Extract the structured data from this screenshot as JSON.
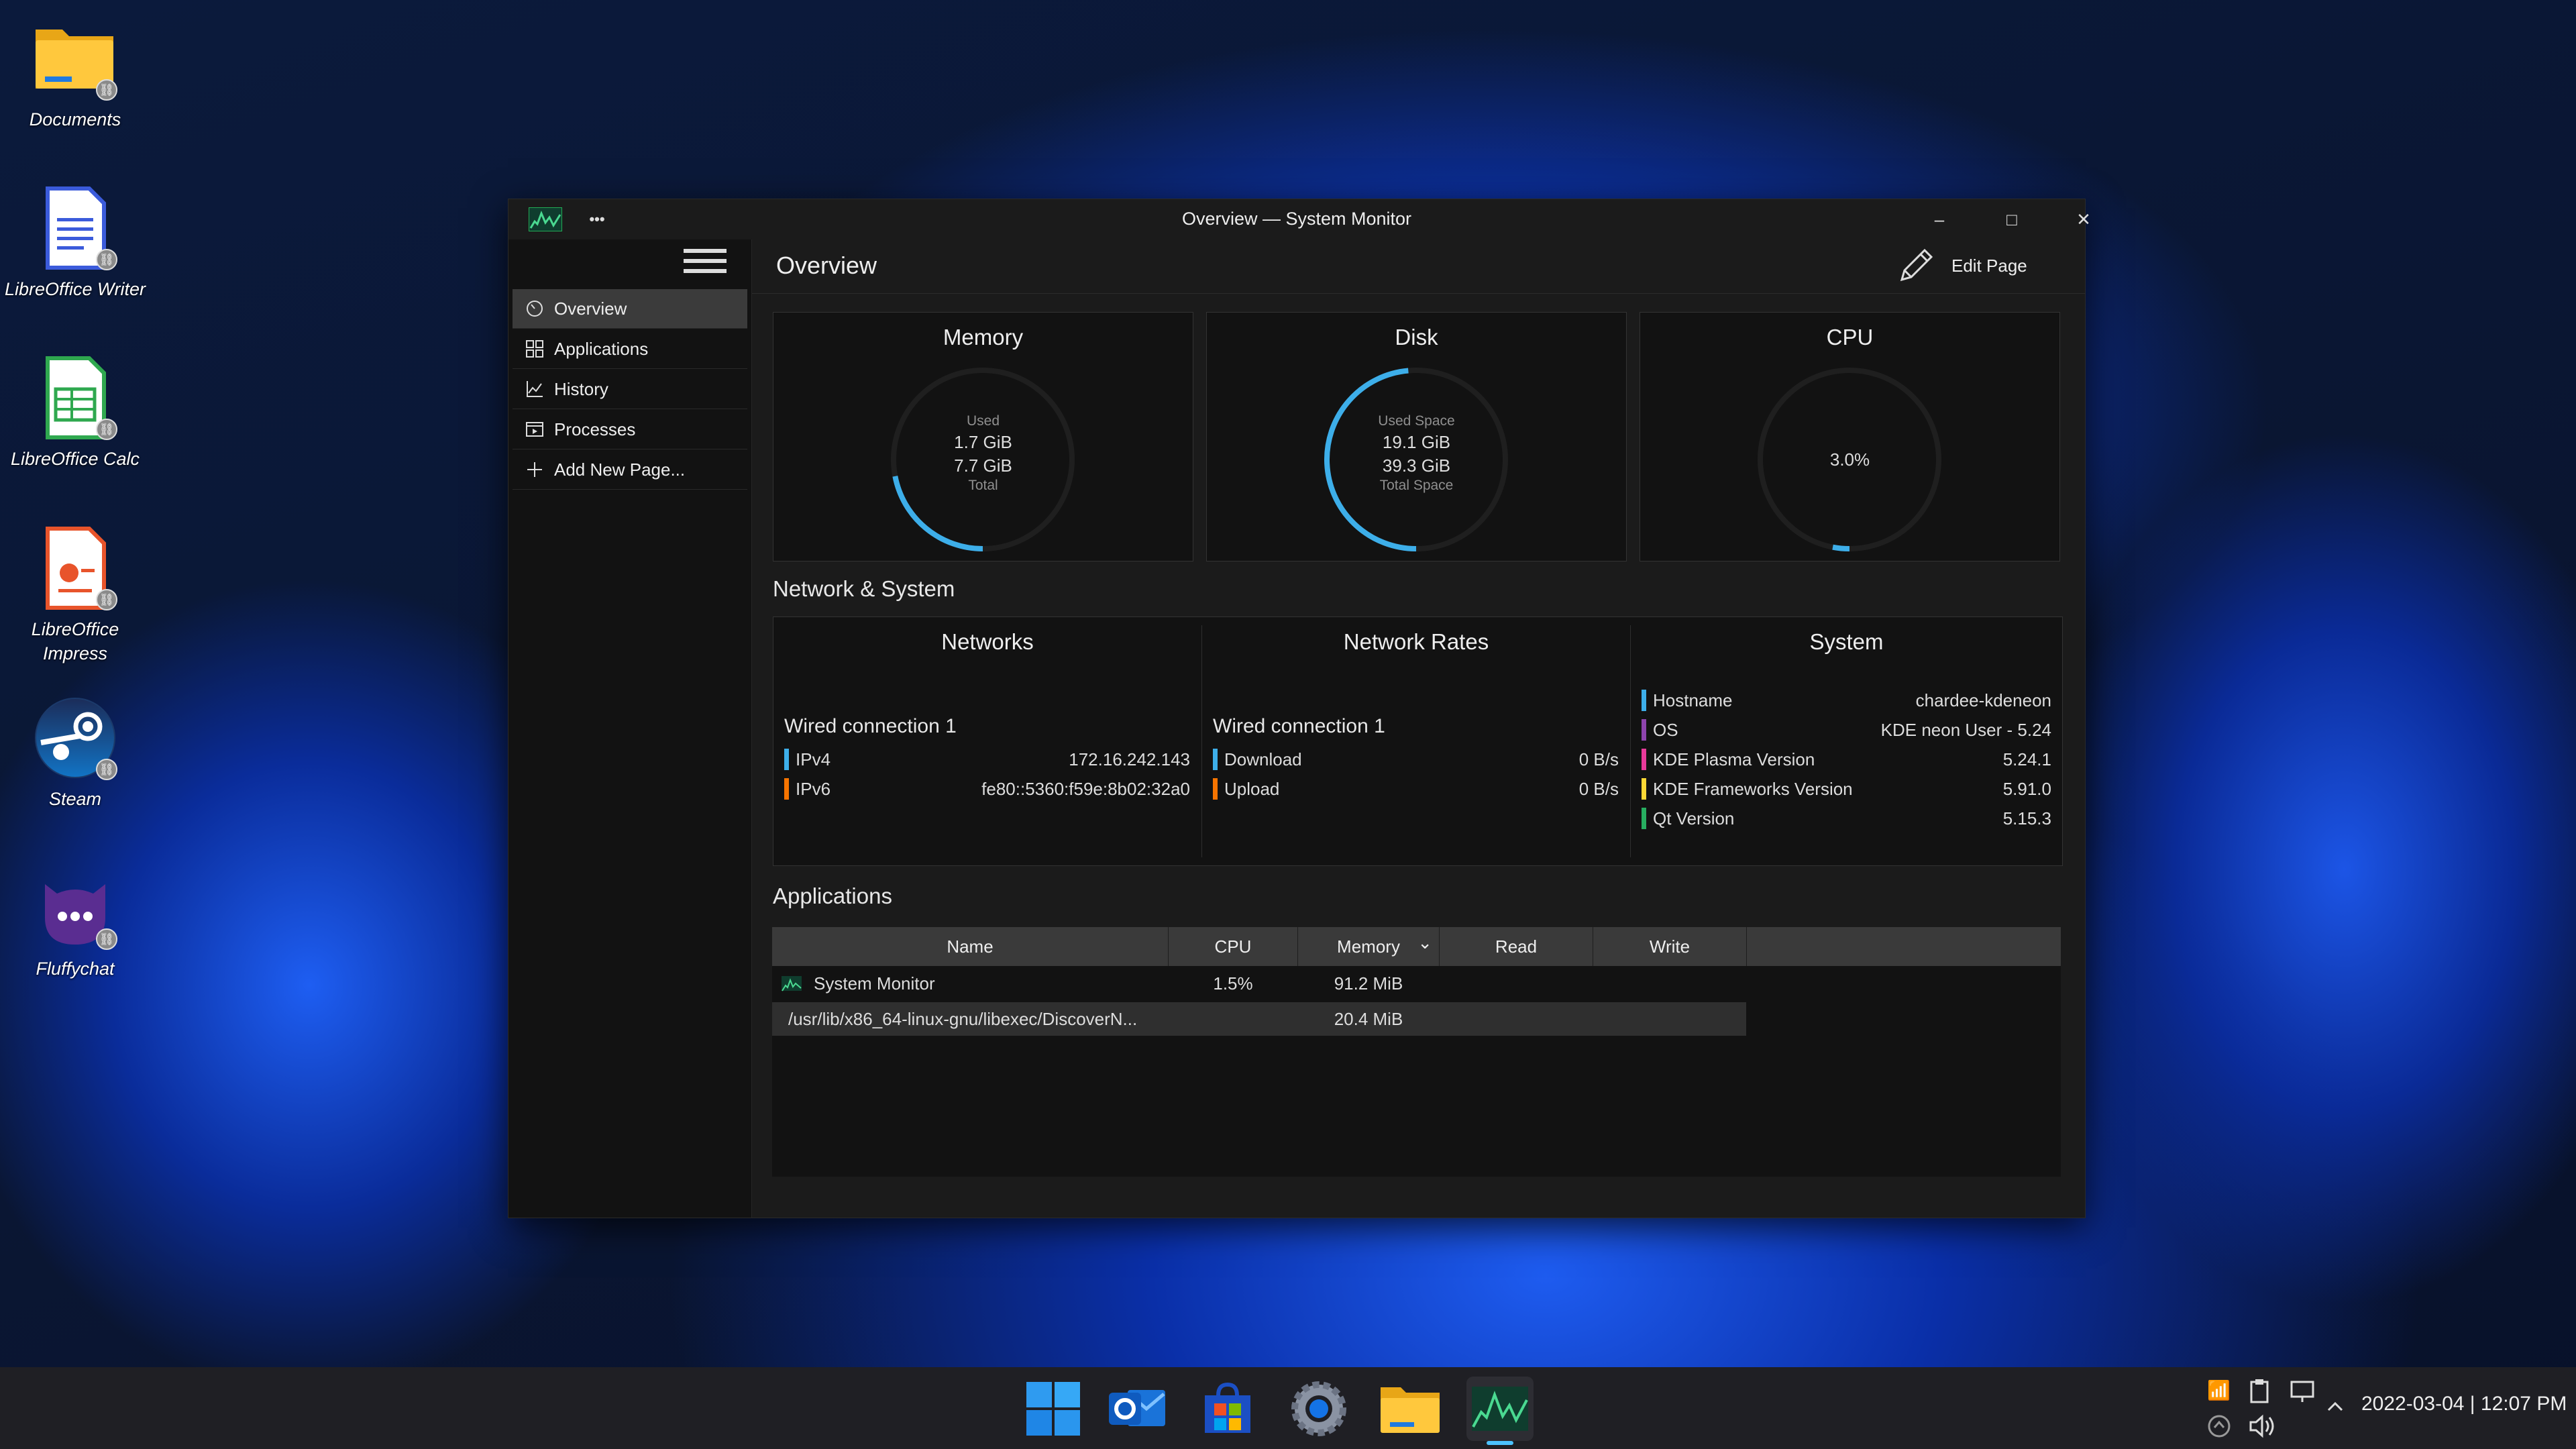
{
  "desktop": {
    "icons": [
      {
        "label": "Documents",
        "icon": "folder-icon"
      },
      {
        "label": "LibreOffice Writer",
        "icon": "libreoffice-writer-icon"
      },
      {
        "label": "LibreOffice Calc",
        "icon": "libreoffice-calc-icon"
      },
      {
        "label": "LibreOffice Impress",
        "icon": "libreoffice-impress-icon"
      },
      {
        "label": "Steam",
        "icon": "steam-icon"
      },
      {
        "label": "Fluffychat",
        "icon": "fluffychat-icon"
      }
    ]
  },
  "window": {
    "title": "Overview — System Monitor",
    "controls": {
      "more": "•••",
      "minimize": "–",
      "maximize": "□",
      "close": "✕"
    }
  },
  "sidebar": {
    "items": [
      {
        "label": "Overview",
        "icon": "overview-icon",
        "active": true
      },
      {
        "label": "Applications",
        "icon": "applications-grid-icon"
      },
      {
        "label": "History",
        "icon": "history-chart-icon"
      },
      {
        "label": "Processes",
        "icon": "processes-icon"
      },
      {
        "label": "Add New Page...",
        "icon": "plus-icon"
      }
    ]
  },
  "header": {
    "title": "Overview",
    "edit_label": "Edit Page"
  },
  "cards": {
    "memory": {
      "title": "Memory",
      "top_label": "Used",
      "used": "1.7 GiB",
      "total": "7.7 GiB",
      "bottom_label": "Total",
      "fraction": 0.22,
      "color": "#3daee9"
    },
    "disk": {
      "title": "Disk",
      "top_label": "Used Space",
      "used": "19.1 GiB",
      "total": "39.3 GiB",
      "bottom_label": "Total Space",
      "fraction": 0.486,
      "color": "#3daee9"
    },
    "cpu": {
      "title": "CPU",
      "value": "3.0%",
      "fraction": 0.03,
      "color": "#3daee9"
    }
  },
  "network_system": {
    "section_title": "Network & System",
    "networks": {
      "title": "Networks",
      "connection": "Wired connection 1",
      "rows": [
        {
          "key": "IPv4",
          "value": "172.16.242.143",
          "color": "#3daee9"
        },
        {
          "key": "IPv6",
          "value": "fe80::5360:f59e:8b02:32a0",
          "color": "#f67400"
        }
      ]
    },
    "rates": {
      "title": "Network Rates",
      "connection": "Wired connection 1",
      "rows": [
        {
          "key": "Download",
          "value": "0 B/s",
          "color": "#3daee9"
        },
        {
          "key": "Upload",
          "value": "0 B/s",
          "color": "#f67400"
        }
      ]
    },
    "system": {
      "title": "System",
      "rows": [
        {
          "key": "Hostname",
          "value": "chardee-kdeneon",
          "color": "#3daee9"
        },
        {
          "key": "OS",
          "value": "KDE neon User - 5.24",
          "color": "#8e44ad"
        },
        {
          "key": "KDE Plasma Version",
          "value": "5.24.1",
          "color": "#e93a9a"
        },
        {
          "key": "KDE Frameworks Version",
          "value": "5.91.0",
          "color": "#fdd835"
        },
        {
          "key": "Qt Version",
          "value": "5.15.3",
          "color": "#27ae60"
        }
      ]
    }
  },
  "applications": {
    "section_title": "Applications",
    "columns": [
      "Name",
      "CPU",
      "Memory",
      "Read",
      "Write"
    ],
    "sort_indicator": "⌄",
    "rows": [
      {
        "name": "System Monitor",
        "cpu": "1.5%",
        "memory": "91.2 MiB",
        "read": "",
        "write": "",
        "icon": "system-monitor-icon"
      },
      {
        "name": "/usr/lib/x86_64-linux-gnu/libexec/DiscoverN...",
        "cpu": "",
        "memory": "20.4 MiB",
        "read": "",
        "write": "",
        "selected": true
      }
    ]
  },
  "taskbar": {
    "apps": [
      "start-icon",
      "outlook-icon",
      "store-icon",
      "settings-icon",
      "file-explorer-icon",
      "system-monitor-icon"
    ],
    "clock": "2022-03-04 | 12:07 PM"
  },
  "colors": {
    "accent": "#3daee9",
    "window_bg": "#1b1b1b",
    "card_bg": "#121212"
  }
}
